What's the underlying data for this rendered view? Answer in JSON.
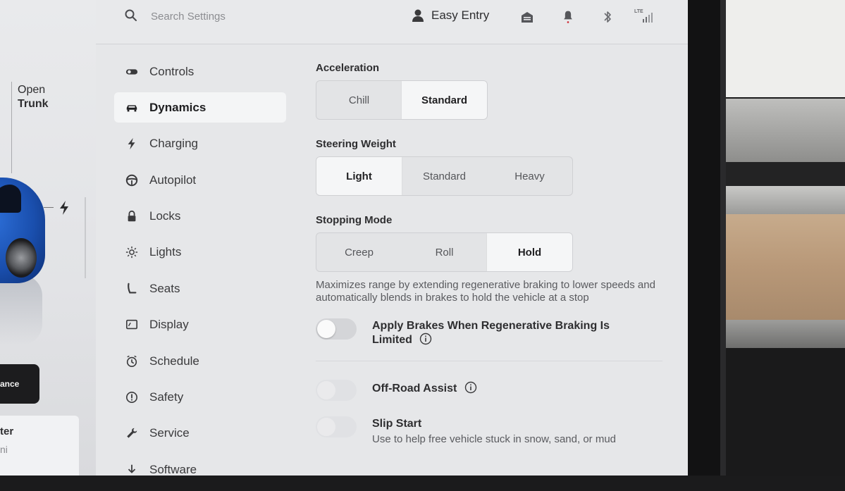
{
  "car_panel": {
    "trunk_line1": "Open",
    "trunk_line2": "Trunk",
    "dark_button_label": "ance",
    "card_line1": "ter",
    "card_line2": "ni"
  },
  "topbar": {
    "search_placeholder": "Search Settings",
    "profile_name": "Easy Entry",
    "lte_label": "LTE"
  },
  "sidebar": {
    "items": [
      {
        "label": "Controls",
        "icon": "toggle-icon"
      },
      {
        "label": "Dynamics",
        "icon": "car-icon",
        "active": true
      },
      {
        "label": "Charging",
        "icon": "bolt-icon"
      },
      {
        "label": "Autopilot",
        "icon": "steering-wheel-icon"
      },
      {
        "label": "Locks",
        "icon": "lock-icon"
      },
      {
        "label": "Lights",
        "icon": "sun-icon"
      },
      {
        "label": "Seats",
        "icon": "seat-icon"
      },
      {
        "label": "Display",
        "icon": "display-icon"
      },
      {
        "label": "Schedule",
        "icon": "clock-icon"
      },
      {
        "label": "Safety",
        "icon": "alert-circle-icon"
      },
      {
        "label": "Service",
        "icon": "wrench-icon"
      },
      {
        "label": "Software",
        "icon": "download-icon"
      }
    ]
  },
  "content": {
    "acceleration": {
      "label": "Acceleration",
      "options": [
        "Chill",
        "Standard"
      ],
      "selected": "Standard"
    },
    "steering_weight": {
      "label": "Steering Weight",
      "options": [
        "Light",
        "Standard",
        "Heavy"
      ],
      "selected": "Light"
    },
    "stopping_mode": {
      "label": "Stopping Mode",
      "options": [
        "Creep",
        "Roll",
        "Hold"
      ],
      "selected": "Hold",
      "description": "Maximizes range by extending regenerative braking to lower speeds and automatically blends in brakes to hold the vehicle at a stop"
    },
    "apply_brakes": {
      "label": "Apply Brakes When Regenerative Braking Is Limited",
      "on": false
    },
    "off_road_assist": {
      "label": "Off-Road Assist",
      "on": false
    },
    "slip_start": {
      "label": "Slip Start",
      "description": "Use to help free vehicle stuck in snow, sand, or mud",
      "on": false
    }
  },
  "colors": {
    "screen_bg": "#e6e7e9",
    "active_nav_bg": "#f4f5f6",
    "selected_segment_bg": "#f5f6f7",
    "notification_dot": "#d0343c"
  }
}
